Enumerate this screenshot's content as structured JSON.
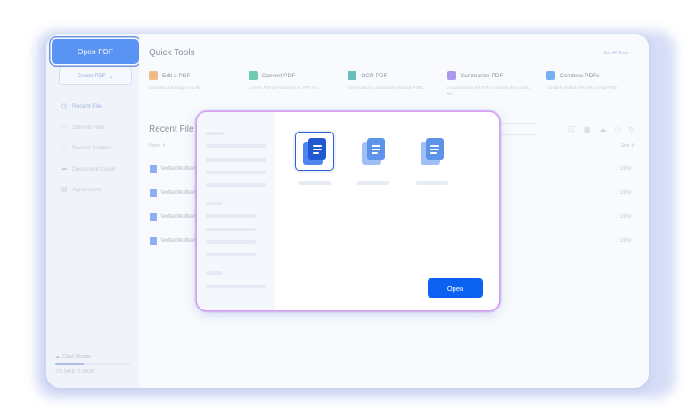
{
  "sidebar": {
    "open_pdf_label": "Open PDF",
    "create_pdf_label": "Create PDF",
    "items": [
      {
        "label": "Recent File",
        "icon": "clock-icon",
        "active": true
      },
      {
        "label": "Starred Files",
        "icon": "star-icon",
        "active": false
      },
      {
        "label": "Recent Folders",
        "icon": "folder-icon",
        "active": false
      },
      {
        "label": "Document Cloud",
        "icon": "cloud-icon",
        "active": false
      },
      {
        "label": "Agreement",
        "icon": "document-icon",
        "active": false
      }
    ],
    "cloud_storage_label": "Cloud Storage",
    "cloud_usage": "778.04KB / 1.00GB",
    "cloud_usage_fraction": 0.38
  },
  "quick_tools": {
    "title": "Quick Tools",
    "see_all": "See All Tools",
    "tools": [
      {
        "name": "Edit a PDF",
        "desc": "Edit texts and images in a file.",
        "color": "#f0a24a"
      },
      {
        "name": "Convert PDF",
        "desc": "Convert PDFs to Word, Excel, PPT, etc.",
        "color": "#2fb98a"
      },
      {
        "name": "OCR PDF",
        "desc": "Turn scans into searchable, editable PDFs.",
        "color": "#21a79a"
      },
      {
        "name": "Summarize PDF",
        "desc": "AI summarizes the PDF's overview, key points, etc.",
        "color": "#8a6be8"
      },
      {
        "name": "Combine PDFs",
        "desc": "Combine multiple files into a single PDF.",
        "color": "#3a8ef0"
      }
    ]
  },
  "recent": {
    "title": "Recent File",
    "col_name": "Name",
    "col_size": "Size",
    "files": [
      {
        "name": "texttexttexttext",
        "size": "102M"
      },
      {
        "name": "texttexttexttext",
        "size": "102M"
      },
      {
        "name": "texttexttexttext",
        "size": "102M"
      },
      {
        "name": "texttexttexttext",
        "size": "102M"
      }
    ]
  },
  "dialog": {
    "open_label": "Open",
    "thumbnails": [
      {
        "selected": true,
        "back": "#4c86ee",
        "front": "#1f58cf"
      },
      {
        "selected": false,
        "back": "#9ec0f6",
        "front": "#5e93ea"
      },
      {
        "selected": false,
        "back": "#9ec0f6",
        "front": "#5e93ea"
      }
    ]
  },
  "colors": {
    "primary": "#0b62f0",
    "modal_glow": "#dd9ef0"
  }
}
